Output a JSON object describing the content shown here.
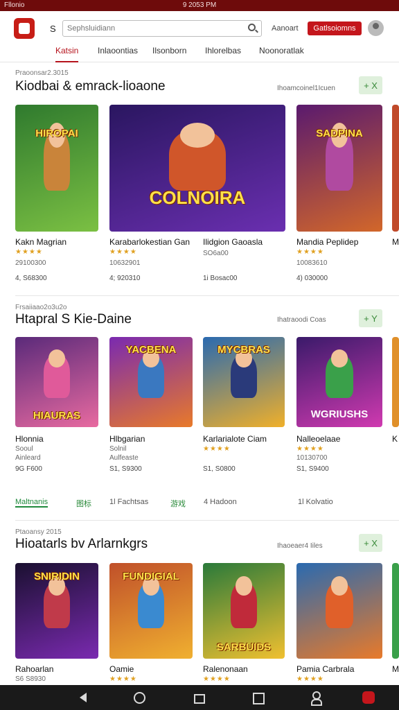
{
  "status_bar": {
    "left": "Fllonio",
    "time": "9 2053 PM"
  },
  "header": {
    "menu_glyph": "S",
    "search_placeholder": "Sephsluidiann",
    "account_label": "Aanoart",
    "cta_label": "Gatlsoiomns"
  },
  "tabs": [
    "Katsin",
    "Inlaoontias",
    "Ilsonborn",
    "Ihlorelbas",
    "Noonoratlak"
  ],
  "sections": [
    {
      "kicker": "Praoonsar2.3015",
      "title": "Kiodbai & emrack-lioaone",
      "meta": "Ihoamcoinel1Icuen",
      "plus_label": "+ X",
      "items": [
        {
          "title": "Kakn Magrian",
          "stars": "★★★★",
          "sub": "29100300",
          "price": "4, S68300",
          "banner": "HIROPAI",
          "colors": [
            "#2f7a2e",
            "#7bc043"
          ]
        },
        {
          "title": "Karabarlokestian Gan",
          "stars": "★★★★",
          "sub": "10632901",
          "price": "4; 920310",
          "banner": "COLNOIRA",
          "colors": [
            "#2a1660",
            "#6a2fb0"
          ]
        },
        {
          "title": "Ilidgion Gaoasla",
          "stars": "",
          "sub": "SO6a00",
          "price": "1i Bosac00",
          "banner": "",
          "colors": []
        },
        {
          "title": "Mandia Peplidep",
          "stars": "★★★★",
          "sub": "10083610",
          "price": "4) 030000",
          "banner": "SADPINA",
          "colors": [
            "#5a1a6e",
            "#d2672a"
          ]
        }
      ]
    },
    {
      "kicker": "Frsaiiaao2o3u2o",
      "title": "Htapral S Kie-Daine",
      "meta": "Ihatraoodi Coas",
      "plus_label": "+ Y",
      "items": [
        {
          "title": "Hlonnia",
          "stars": "",
          "sub": "Sooul",
          "price": "9G F600",
          "extra": "Ainleard",
          "banner": "HIAURAS",
          "colors": [
            "#5a2a7a",
            "#e86aa0"
          ]
        },
        {
          "title": "Hlbgarian",
          "stars": "",
          "sub": "Solnil",
          "price": "S1, S9300",
          "extra": "Aulfeaste",
          "banner": "YACBENA",
          "colors": [
            "#7a2ab0",
            "#e87a2a"
          ]
        },
        {
          "title": "Karlarialote Ciam",
          "stars": "★★★★",
          "sub": "",
          "price": "S1, S0800",
          "banner": "MYCBRAS",
          "colors": [
            "#2a6ab0",
            "#f0b02a"
          ]
        },
        {
          "title": "Nalleoelaae",
          "stars": "★★★★",
          "sub": "10130700",
          "price": "S1, S9400",
          "banner": "WGRIUSHS",
          "colors": [
            "#3a1a6a",
            "#d03ab0"
          ]
        }
      ]
    },
    {
      "kicker": "Ptaoansy 2015",
      "title": "Hioatarls bv Arlarnkgrs",
      "meta": "Ihaoeaer4 Iiles",
      "plus_label": "+ X",
      "items": [
        {
          "title": "Rahoarlan",
          "stars": "",
          "sub": "S6 S8930",
          "price": "",
          "banner": "SNIRIDIN",
          "colors": [
            "#1a1030",
            "#7a2ab0"
          ]
        },
        {
          "title": "Oamie",
          "stars": "★★★★",
          "sub": "",
          "price": "",
          "banner": "FUNDIGIAL",
          "colors": [
            "#c0502a",
            "#f0b030"
          ]
        },
        {
          "title": "Ralenonaan",
          "stars": "★★★★",
          "sub": "",
          "price": "",
          "banner": "SARBUIDS",
          "colors": [
            "#2a7a3a",
            "#f0c030"
          ]
        },
        {
          "title": "Pamia Carbrala",
          "stars": "★★★★",
          "sub": "",
          "price": "",
          "banner": "",
          "colors": [
            "#2a6ab0",
            "#e87a2a"
          ]
        }
      ]
    }
  ],
  "filters": [
    "Maltnanis",
    "图标",
    "1l Fachtsas",
    "游戏",
    "4 Hadoon",
    "1l Kolvatio"
  ],
  "peek_titles": [
    "M",
    "K",
    "M"
  ]
}
